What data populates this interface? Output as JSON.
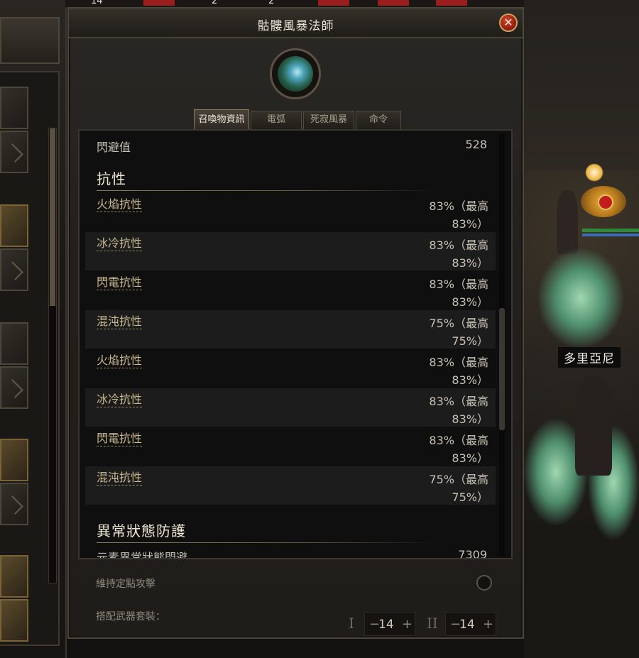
{
  "window": {
    "title": "骷髏風暴法師",
    "close_symbol": "✕"
  },
  "top_strip": {
    "numbers": [
      "14",
      "2",
      "2"
    ]
  },
  "tabs": [
    {
      "label": "召喚物資訊",
      "active": true
    },
    {
      "label": "電弧",
      "active": false
    },
    {
      "label": "死寂風暴",
      "active": false
    },
    {
      "label": "命令",
      "active": false
    }
  ],
  "stats": {
    "evasion": {
      "label": "閃避值",
      "value": "528"
    },
    "resistance_section": "抗性",
    "resistances": [
      {
        "label": "火焰抗性",
        "value": "83%（最高 83%）"
      },
      {
        "label": "冰冷抗性",
        "value": "83%（最高 83%）"
      },
      {
        "label": "閃電抗性",
        "value": "83%（最高 83%）"
      },
      {
        "label": "混沌抗性",
        "value": "75%（最高 75%）"
      },
      {
        "label": "火焰抗性",
        "value": "83%（最高 83%）"
      },
      {
        "label": "冰冷抗性",
        "value": "83%（最高 83%）"
      },
      {
        "label": "閃電抗性",
        "value": "83%（最高 83%）"
      },
      {
        "label": "混沌抗性",
        "value": "75%（最高 75%）"
      }
    ],
    "ailment_section": "異常狀態防護",
    "partial_row": {
      "label": "元素異常狀態閃避",
      "value": "7309"
    }
  },
  "footer": {
    "hold_attack_label": "維持定點攻擊",
    "weapon_set_label": "搭配武器套裝：",
    "set1": {
      "roman": "I",
      "value": "14",
      "minus": "−",
      "plus": "+"
    },
    "set2": {
      "roman": "II",
      "value": "14",
      "minus": "−",
      "plus": "+"
    }
  },
  "scene": {
    "npc_name": "多里亞尼"
  },
  "icons": [
    "close-icon",
    "minion-portrait-icon",
    "chevron-icon"
  ],
  "colors": {
    "accent_gold": "#c9b98f",
    "panel_bg": "#0f0f0f",
    "close_red": "#8a1c10"
  }
}
